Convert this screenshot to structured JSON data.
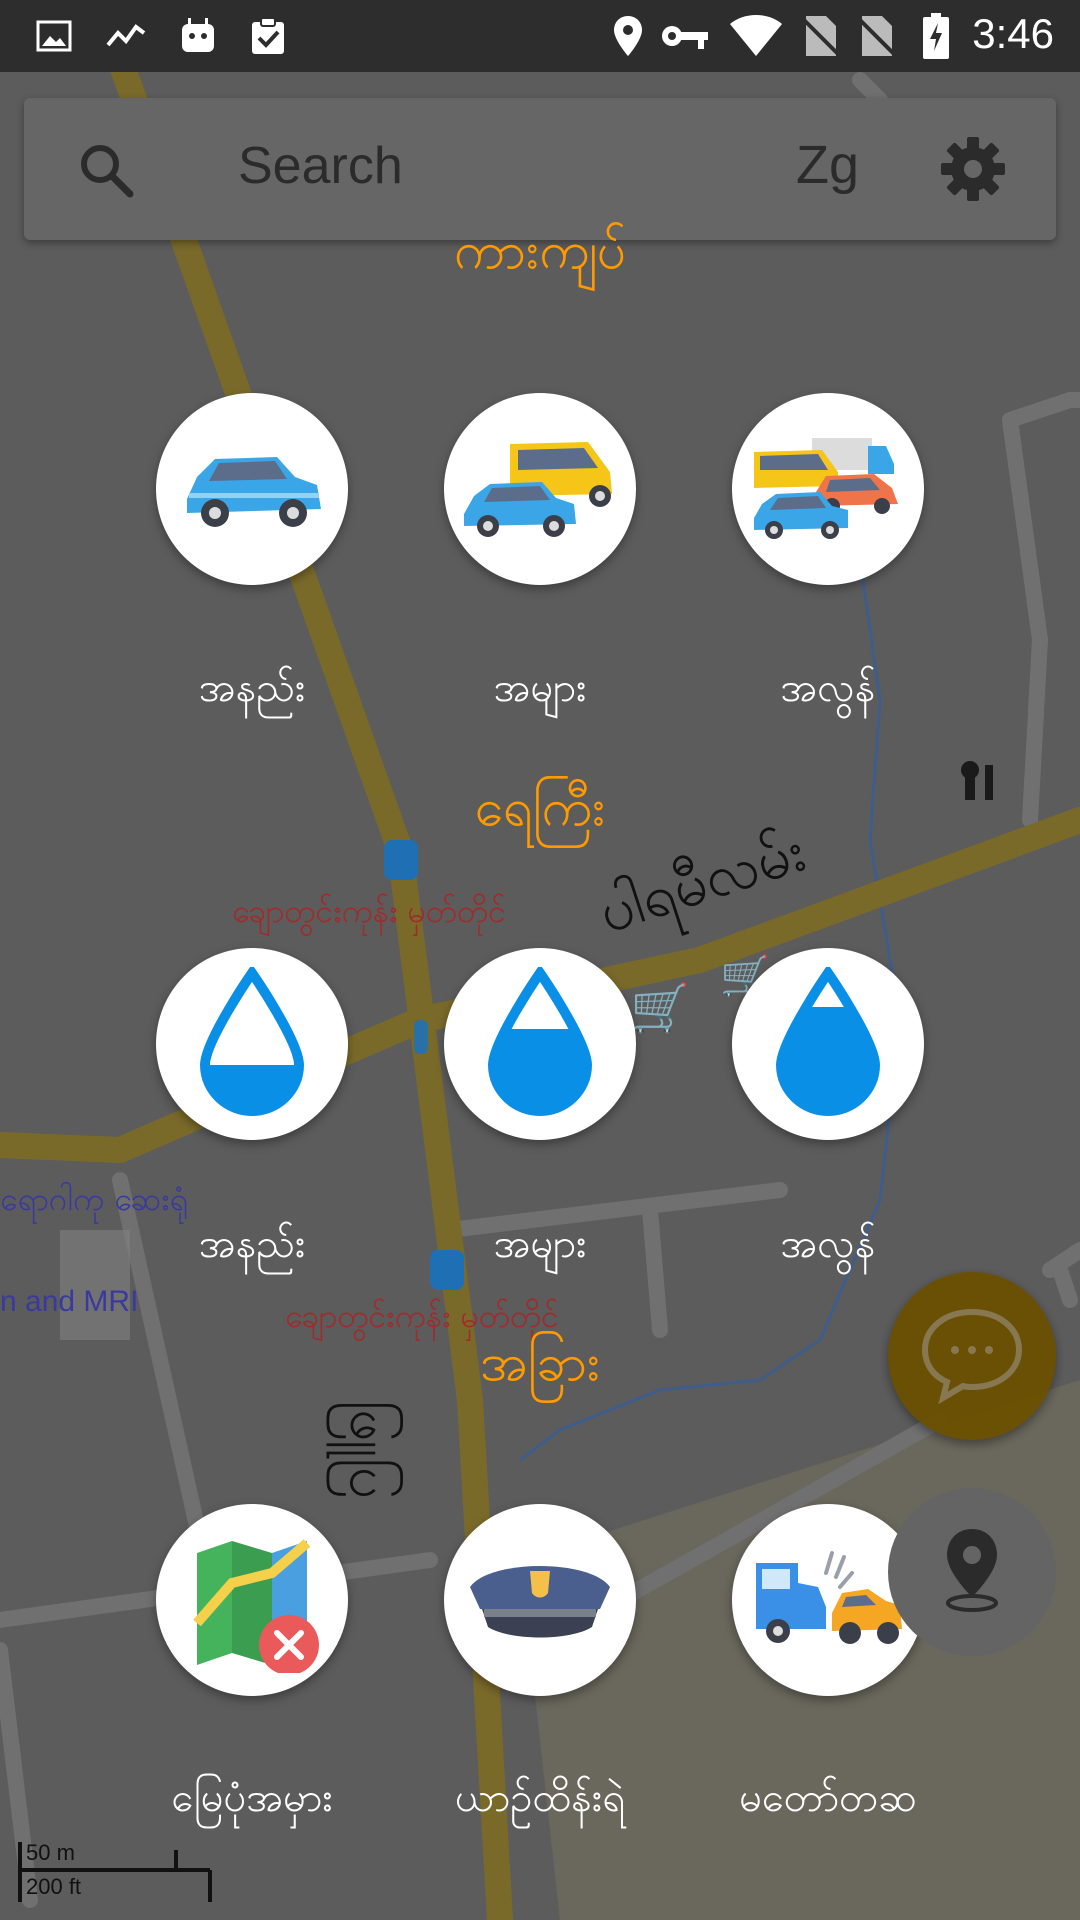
{
  "status_bar": {
    "time": "3:46",
    "icons": [
      "image-icon",
      "activity-icon",
      "android-icon",
      "clipboard-check-icon",
      "location-icon",
      "vpn-key-icon",
      "wifi-icon",
      "no-sim-icon",
      "no-sim-icon",
      "battery-charging-icon"
    ]
  },
  "search": {
    "placeholder": "Search",
    "font_toggle": "Zg",
    "icons": [
      "search-icon",
      "gear-icon"
    ]
  },
  "sections": [
    {
      "title": "ကားကျပ်",
      "items": [
        {
          "label": "အနည်း",
          "icon": "car-icon"
        },
        {
          "label": "အများ",
          "icon": "car-and-van-icon"
        },
        {
          "label": "အလွန်",
          "icon": "traffic-jam-icon"
        }
      ]
    },
    {
      "title": "ရေကြီး",
      "items": [
        {
          "label": "အနည်း",
          "icon": "water-drop-low-icon"
        },
        {
          "label": "အများ",
          "icon": "water-drop-medium-icon"
        },
        {
          "label": "အလွန်",
          "icon": "water-drop-high-icon"
        }
      ]
    },
    {
      "title": "အခြား",
      "items": [
        {
          "label": "မြေပုံအမှား",
          "icon": "map-error-icon"
        },
        {
          "label": "ယာဉ်ထိန်းရဲ",
          "icon": "police-cap-icon"
        },
        {
          "label": "မတော်တဆ",
          "icon": "car-accident-icon"
        }
      ]
    }
  ],
  "map_labels": {
    "bus_stop_1": "ချောတွင်းကုန်း မှတ်တိုင်",
    "bus_stop_2": "ချောတွင်းကုန်း မှတ်တိုင်",
    "road_name": "ပါရမီလမ်း",
    "hospital": "ရောဂါကု ဆေးရုံ",
    "mri": "n and MRI",
    "vertical_road": "ဖြူပြ"
  },
  "scale": {
    "metric": "50 m",
    "imperial": "200 ft"
  },
  "fabs": {
    "chat": "chat-bubble-icon",
    "location": "location-pin-icon"
  },
  "colors": {
    "accent": "#ff9a00",
    "map_bg": "#5a5a5a",
    "road_major": "#7a6a2a",
    "water_drop": "#0a8fe6",
    "chat_fab": "#6b5000"
  }
}
